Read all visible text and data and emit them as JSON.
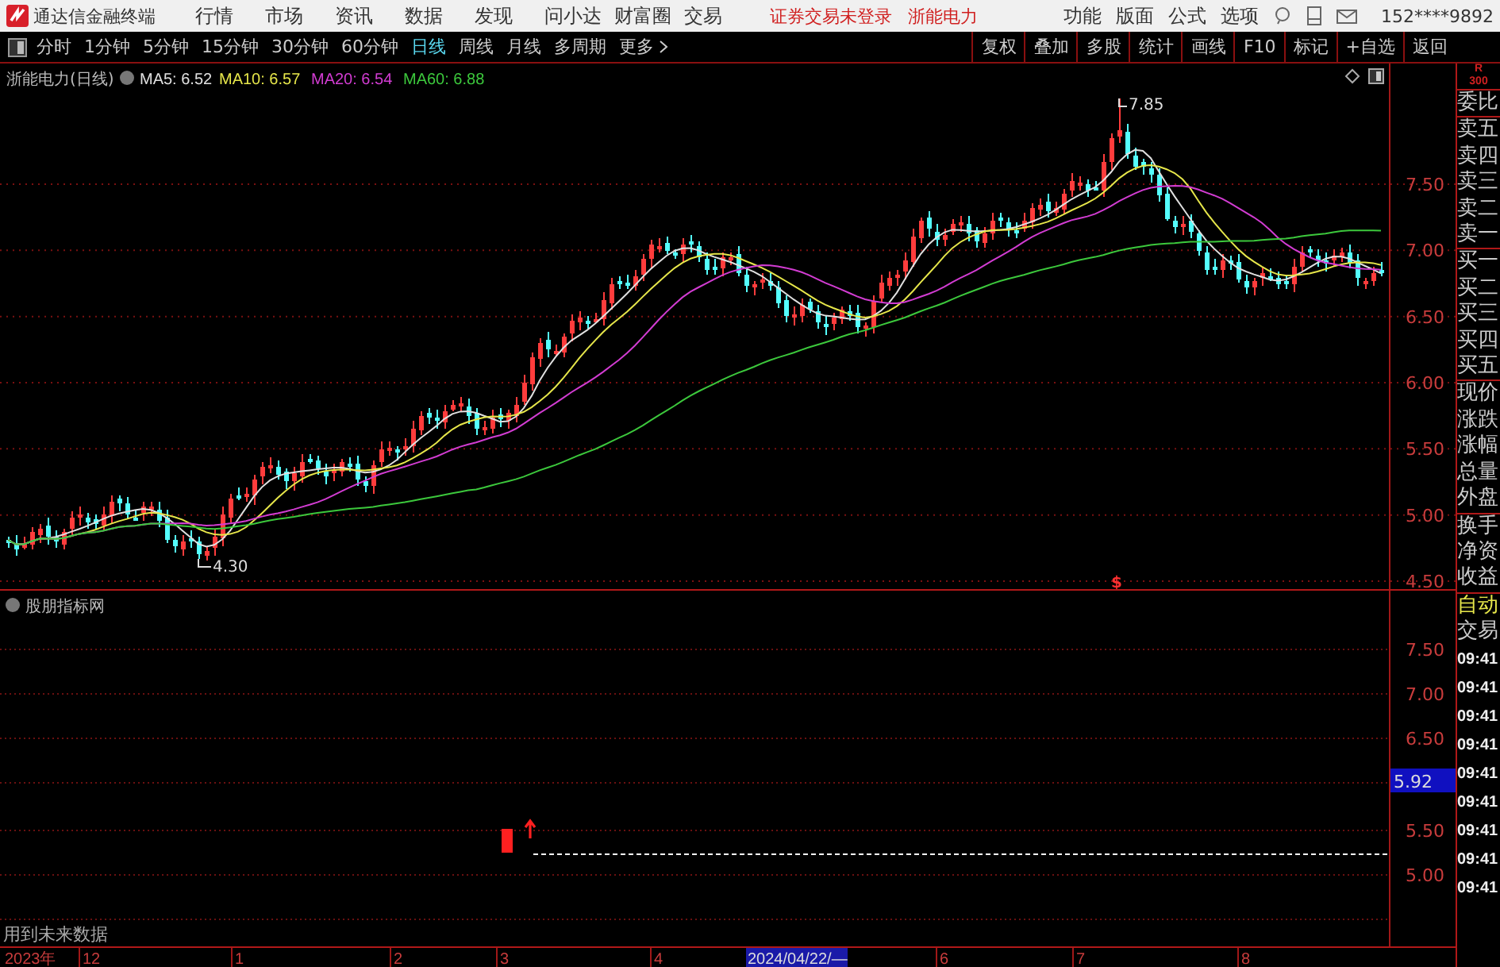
{
  "app": {
    "title": "通达信金融终端",
    "menu": [
      "行情",
      "市场",
      "资讯",
      "数据",
      "发现",
      "问小达",
      "财富圈",
      "交易"
    ],
    "status": [
      "证券交易未登录",
      "浙能电力"
    ],
    "right_menu": [
      "功能",
      "版面",
      "公式",
      "选项"
    ],
    "account": "152****9892"
  },
  "periods": [
    {
      "label": "分时",
      "selected": false
    },
    {
      "label": "1分钟",
      "selected": false
    },
    {
      "label": "5分钟",
      "selected": false
    },
    {
      "label": "15分钟",
      "selected": false
    },
    {
      "label": "30分钟",
      "selected": false
    },
    {
      "label": "60分钟",
      "selected": false
    },
    {
      "label": "日线",
      "selected": true
    },
    {
      "label": "周线",
      "selected": false
    },
    {
      "label": "月线",
      "selected": false
    },
    {
      "label": "多周期",
      "selected": false
    },
    {
      "label": "更多",
      "selected": false
    }
  ],
  "tools": [
    "复权",
    "叠加",
    "多股",
    "统计",
    "画线",
    "F10",
    "标记",
    "+自选",
    "返回"
  ],
  "main_chart": {
    "title": "浙能电力(日线)",
    "moving_averages": [
      {
        "label": "MA5: 6.52",
        "color": "#e0e0e0"
      },
      {
        "label": "MA10: 6.57",
        "color": "#e6e64a"
      },
      {
        "label": "MA20: 6.54",
        "color": "#d23cd2"
      },
      {
        "label": "MA60: 6.88",
        "color": "#3cc83c"
      }
    ],
    "price_ticks": [
      "7.50",
      "7.00",
      "6.50",
      "6.00",
      "5.50",
      "5.00",
      "4.50"
    ],
    "high_label": "7.85",
    "low_label": "4.30",
    "marker": "$"
  },
  "indicator": {
    "title": "股朋指标网",
    "ticks": [
      "7.50",
      "7.00",
      "6.50",
      "5.50",
      "5.00"
    ],
    "current_value": "5.92",
    "note": "用到未来数据"
  },
  "time_axis": [
    {
      "label": "2023年",
      "selected": false
    },
    {
      "label": "12",
      "selected": false
    },
    {
      "label": "1",
      "selected": false
    },
    {
      "label": "2",
      "selected": false
    },
    {
      "label": "3",
      "selected": false
    },
    {
      "label": "4",
      "selected": false
    },
    {
      "label": "2024/04/22/—",
      "selected": true
    },
    {
      "label": "6",
      "selected": false
    },
    {
      "label": "7",
      "selected": false
    },
    {
      "label": "8",
      "selected": false
    }
  ],
  "quote_panel": {
    "badge": [
      "R",
      "300"
    ],
    "groups": [
      [
        "委比"
      ],
      [
        "卖五",
        "卖四",
        "卖三",
        "卖二",
        "卖一"
      ],
      [
        "买一",
        "买二",
        "买三",
        "买四",
        "买五"
      ],
      [
        "现价",
        "涨跌",
        "涨幅",
        "总量",
        "外盘"
      ],
      [
        "换手",
        "净资",
        "收益"
      ]
    ],
    "auto": "自动",
    "trade": "交易",
    "times": [
      "09:41",
      "09:41",
      "09:41",
      "09:41",
      "09:41",
      "09:41",
      "09:41",
      "09:41",
      "09:41"
    ]
  }
}
